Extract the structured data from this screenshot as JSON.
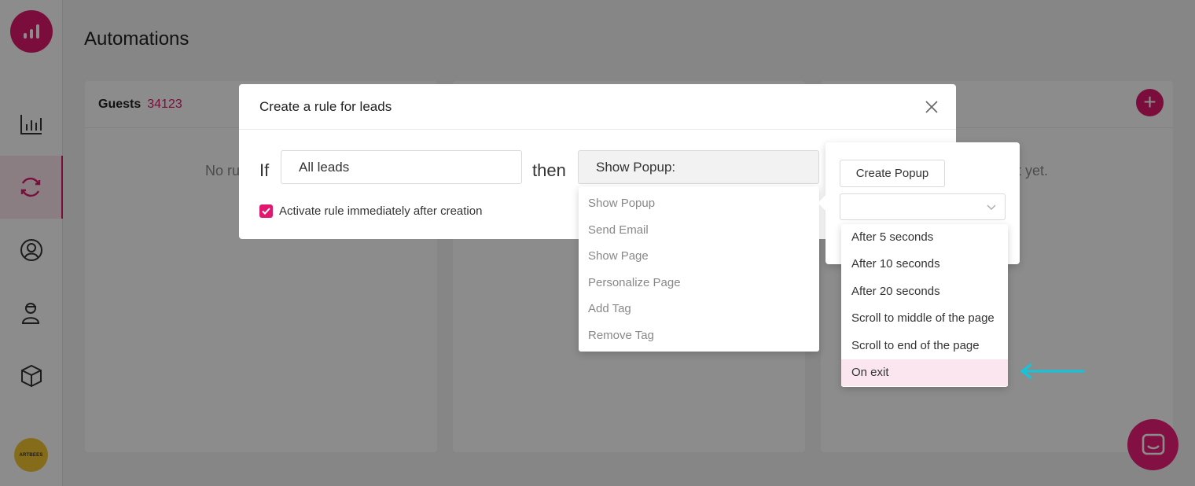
{
  "page": {
    "title": "Automations"
  },
  "sidebar": {
    "logo_icon": "bar-chart-logo-icon",
    "items": [
      {
        "name": "analytics",
        "icon": "bar-chart-icon",
        "active": false
      },
      {
        "name": "automations",
        "icon": "sync-icon",
        "active": true
      },
      {
        "name": "audience",
        "icon": "user-circle-icon",
        "active": false
      },
      {
        "name": "leads",
        "icon": "person-icon",
        "active": false
      },
      {
        "name": "products",
        "icon": "cube-icon",
        "active": false
      }
    ],
    "avatar_text": "ARTBEES"
  },
  "columns": [
    {
      "name": "Guests",
      "count": "34123",
      "empty_text": "No ru"
    },
    {
      "name": "",
      "count": "",
      "empty_text": ""
    },
    {
      "name": "",
      "count": "",
      "empty_text": "t yet."
    }
  ],
  "modal": {
    "title": "Create a rule for leads",
    "if_label": "If",
    "then_label": "then",
    "lead_filter_value": "All leads",
    "action_value": "Show Popup:",
    "activate_label": "Activate rule immediately after creation",
    "activate_checked": true
  },
  "action_options": [
    "Show Popup",
    "Send Email",
    "Show Page",
    "Personalize Page",
    "Add Tag",
    "Remove Tag"
  ],
  "popup_panel": {
    "create_button": "Create Popup",
    "timing_select_value": ""
  },
  "timing_options": [
    "After 5 seconds",
    "After 10 seconds",
    "After 20 seconds",
    "Scroll to middle of the page",
    "Scroll to end of the page",
    "On exit"
  ],
  "timing_selected": "On exit",
  "colors": {
    "accent": "#e0196f",
    "annotation_arrow": "#11c6dc",
    "chat": "#ef1e7a"
  }
}
